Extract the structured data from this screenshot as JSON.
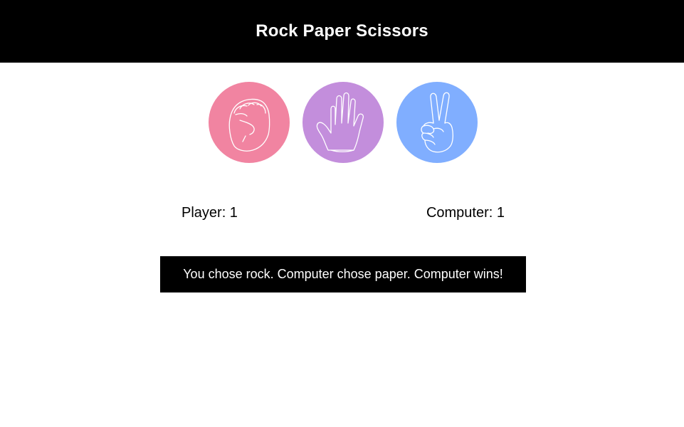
{
  "header": {
    "title": "Rock Paper Scissors"
  },
  "choices": [
    {
      "id": "rock",
      "icon": "fist-icon",
      "color": "#f184a1"
    },
    {
      "id": "paper",
      "icon": "open-hand-icon",
      "color": "#c38edc"
    },
    {
      "id": "scissors",
      "icon": "victory-hand-icon",
      "color": "#80aeff"
    }
  ],
  "scores": {
    "player_label": "Player: 1",
    "player_value": 1,
    "computer_label": "Computer: 1",
    "computer_value": 1
  },
  "result": {
    "message": "You chose rock. Computer chose paper. Computer wins!"
  },
  "colors": {
    "header_bg": "#000000",
    "result_bg": "#000000",
    "text_on_dark": "#ffffff"
  }
}
